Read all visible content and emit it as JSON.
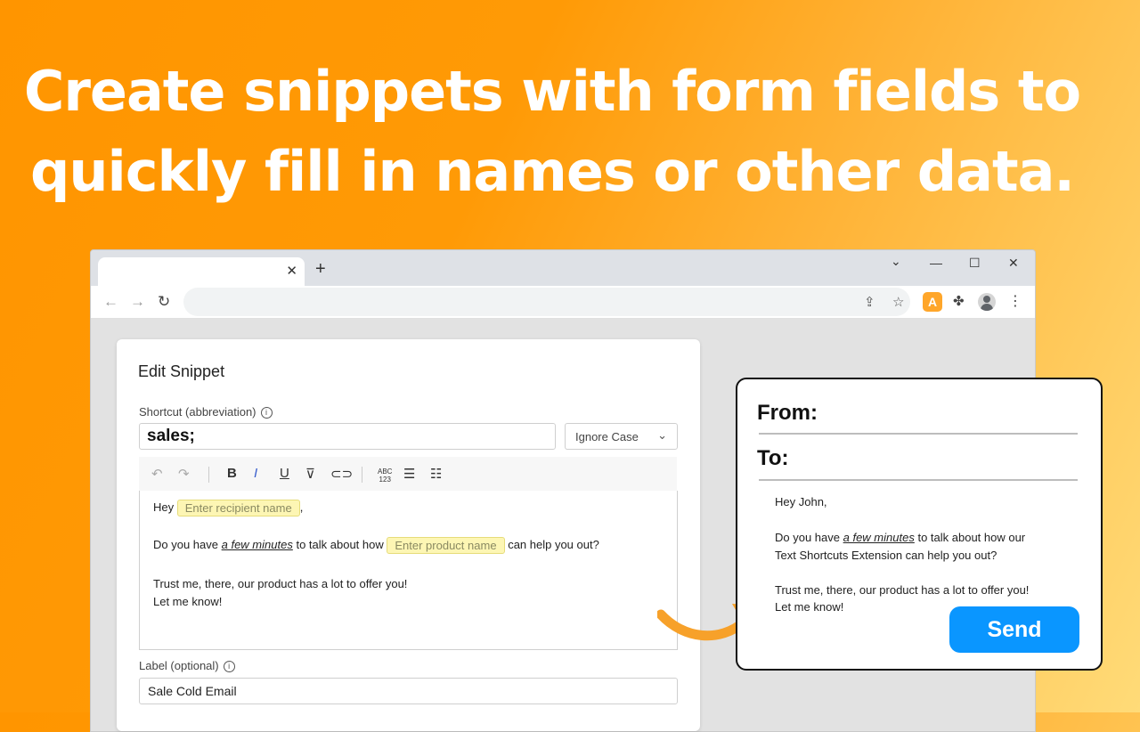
{
  "headline": {
    "line1": "Create snippets with form fields to",
    "line2": "quickly fill in names or other data."
  },
  "browser": {
    "tab_close": "✕",
    "new_tab": "+",
    "window_controls": {
      "dropdown": "⌄",
      "minimize": "—",
      "maximize": "☐",
      "close": "✕"
    },
    "nav": {
      "back": "←",
      "forward": "→",
      "reload": "↻"
    },
    "extension_badge": "A",
    "icons": [
      "share-icon",
      "star-icon",
      "text-shortcuts-extension-icon",
      "puzzle-icon",
      "profile-icon",
      "menu-icon"
    ]
  },
  "editor": {
    "title": "Edit Snippet",
    "shortcut_label": "Shortcut (abbreviation)",
    "shortcut_value": "sales;",
    "case_option": "Ignore Case",
    "body": {
      "greeting_prefix": "Hey",
      "recipient_placeholder": "Enter recipient name",
      "greeting_suffix": ",",
      "question_prefix": "Do you have",
      "question_emph": "a few minutes",
      "question_mid": "to talk about how",
      "product_placeholder": "Enter product name",
      "question_suffix": "can help you out?",
      "line3": "Trust me, there, our product has a lot to offer you!",
      "line4": "Let me know!"
    },
    "label_label": "Label (optional)",
    "label_value": "Sale Cold Email"
  },
  "preview": {
    "from_label": "From:",
    "to_label": "To:",
    "greeting": "Hey John,",
    "line2_prefix": "Do you have",
    "line2_emph": "a few minutes",
    "line2_suffix": "to talk about how our",
    "line3": "Text Shortcuts Extension can help you out?",
    "line4": "Trust me, there, our product has a lot to offer you!",
    "line5": "Let me know!",
    "send_label": "Send"
  },
  "colors": {
    "background_start": "#ff9500",
    "background_end": "#ffdb78",
    "send_button": "#0a96ff",
    "arrow": "#f7a12a",
    "fillin": "#fdf6b4"
  }
}
